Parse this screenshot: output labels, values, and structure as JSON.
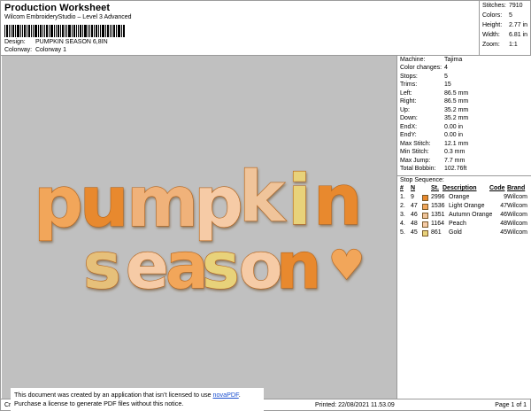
{
  "header": {
    "title": "Production Worksheet",
    "app": "Wilcom EmbroideryStudio – Level 3 Advanced",
    "design_label": "Design:",
    "design_value": "PUMPKIN SEASON 6,8IN",
    "colorway_label": "Colorway:",
    "colorway_value": "Colorway 1"
  },
  "summary": {
    "stitches_label": "Stitches:",
    "stitches": "7910",
    "colors_label": "Colors:",
    "colors": "5",
    "height_label": "Height:",
    "height": "2.77 in",
    "width_label": "Width:",
    "width": "6.81 in",
    "zoom_label": "Zoom:",
    "zoom": "1:1"
  },
  "design_text": {
    "line1": [
      "p",
      "u",
      "m",
      "p",
      "k",
      "i",
      "n"
    ],
    "line2": [
      "s",
      "e",
      "a",
      "s",
      "o",
      "n"
    ],
    "heart": "♥"
  },
  "machine": [
    {
      "k": "Machine:",
      "v": "Tajima"
    },
    {
      "k": "Color changes:",
      "v": "4"
    },
    {
      "k": "Stops:",
      "v": "5"
    },
    {
      "k": "Trims:",
      "v": "15"
    },
    {
      "k": "Left:",
      "v": "86.5 mm"
    },
    {
      "k": "Right:",
      "v": "86.5 mm"
    },
    {
      "k": "Up:",
      "v": "35.2 mm"
    },
    {
      "k": "Down:",
      "v": "35.2 mm"
    },
    {
      "k": "EndX:",
      "v": "0.00 in"
    },
    {
      "k": "EndY:",
      "v": "0.00 in"
    },
    {
      "k": "Max Stitch:",
      "v": "12.1 mm"
    },
    {
      "k": "Min Stitch:",
      "v": "0.3 mm"
    },
    {
      "k": "Max Jump:",
      "v": "7.7 mm"
    },
    {
      "k": "Total Bobbin:",
      "v": "102.76ft"
    }
  ],
  "stop_sequence": {
    "title": "Stop Sequence:",
    "headers": {
      "num": "#",
      "n": "N",
      "st": "St.",
      "desc": "Description",
      "code": "Code",
      "brand": "Brand"
    },
    "rows": [
      {
        "idx": "1.",
        "n": "9",
        "color": "#e8892e",
        "st": "2996",
        "desc": "Orange",
        "code": "9",
        "brand": "Wilcom"
      },
      {
        "idx": "2.",
        "n": "47",
        "color": "#f2a65a",
        "st": "1536",
        "desc": "Light Orange",
        "code": "47",
        "brand": "Wilcom"
      },
      {
        "idx": "3.",
        "n": "46",
        "color": "#f0c49a",
        "st": "1351",
        "desc": "Autumn Orange",
        "code": "46",
        "brand": "Wilcom"
      },
      {
        "idx": "4.",
        "n": "48",
        "color": "#f6cba6",
        "st": "1164",
        "desc": "Peach",
        "code": "48",
        "brand": "Wilcom"
      },
      {
        "idx": "5.",
        "n": "45",
        "color": "#e8d27a",
        "st": "861",
        "desc": "Gold",
        "code": "45",
        "brand": "Wilcom"
      }
    ]
  },
  "footer": {
    "cr": "Cr",
    "printed": "Printed: 22/08/2021 11.53.09",
    "page": "Page 1 of 1",
    "notice_line1": "This document was created by an application that isn’t licensed to use ",
    "notice_link": "novaPDF",
    "notice_line1_end": ".",
    "notice_line2": "Purchase a license to generate PDF files without this notice."
  }
}
